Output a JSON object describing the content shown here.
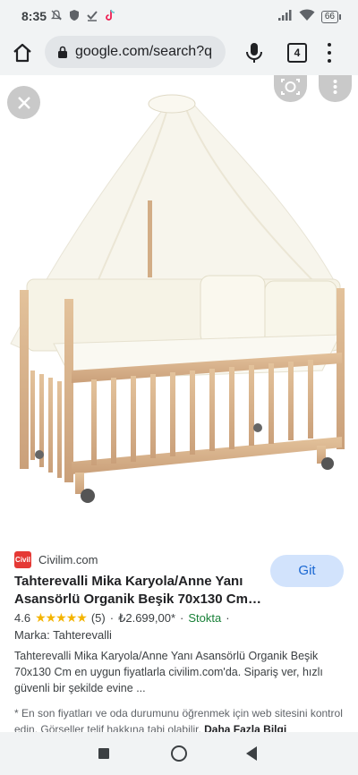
{
  "status": {
    "time": "8:35",
    "battery": "66"
  },
  "browser": {
    "url": "google.com/search?q",
    "tab_count": "4"
  },
  "result": {
    "source": "Civilim.com",
    "favicon_text": "Civil",
    "go_button": "Git",
    "title": "Tahterevalli Mika Karyola/Anne Yanı Asansörlü Organik Beşik 70x130 Cm…",
    "rating": "4.6",
    "stars": "★★★★★",
    "review_count": "(5)",
    "separator": "·",
    "price": "₺2.699,00*",
    "stock": "Stokta",
    "brand": "Marka: Tahterevalli",
    "description": "Tahterevalli Mika Karyola/Anne Yanı Asansörlü Organik Beşik 70x130 Cm en uygun fiyatlarla civilim.com'da. Sipariş ver, hızlı güvenli bir şekilde evine ...",
    "note": "* En son fiyatları ve oda durumunu öğrenmek için web sitesini kontrol edin. Görseller telif hakkına tabi olabilir.",
    "more_link": "Daha Fazla Bilgi"
  },
  "colors": {
    "accent": "#1967d2",
    "stock": "#188038",
    "star": "#f4b400"
  },
  "icons": [
    "mute-icon",
    "shield-icon",
    "check-icon",
    "tiktok-icon",
    "signal-icon",
    "wifi-icon",
    "battery-icon",
    "home-icon",
    "lock-icon",
    "mic-icon",
    "tabs-icon",
    "menu-icon",
    "close-icon",
    "lens-icon",
    "more-icon"
  ]
}
